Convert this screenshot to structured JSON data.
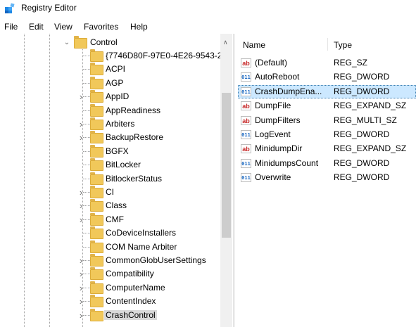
{
  "window": {
    "title": "Registry Editor",
    "app_icon": "registry-icon"
  },
  "menu": [
    "File",
    "Edit",
    "View",
    "Favorites",
    "Help"
  ],
  "tree": {
    "parent": {
      "label": "Control",
      "expanded": true
    },
    "items": [
      {
        "label": "{7746D80F-97E0-4E26-9543-2",
        "expandable": false,
        "selected": false
      },
      {
        "label": "ACPI",
        "expandable": false,
        "selected": false
      },
      {
        "label": "AGP",
        "expandable": false,
        "selected": false
      },
      {
        "label": "AppID",
        "expandable": true,
        "selected": false
      },
      {
        "label": "AppReadiness",
        "expandable": false,
        "selected": false
      },
      {
        "label": "Arbiters",
        "expandable": true,
        "selected": false
      },
      {
        "label": "BackupRestore",
        "expandable": true,
        "selected": false
      },
      {
        "label": "BGFX",
        "expandable": false,
        "selected": false
      },
      {
        "label": "BitLocker",
        "expandable": false,
        "selected": false
      },
      {
        "label": "BitlockerStatus",
        "expandable": false,
        "selected": false
      },
      {
        "label": "CI",
        "expandable": true,
        "selected": false
      },
      {
        "label": "Class",
        "expandable": true,
        "selected": false
      },
      {
        "label": "CMF",
        "expandable": true,
        "selected": false
      },
      {
        "label": "CoDeviceInstallers",
        "expandable": false,
        "selected": false
      },
      {
        "label": "COM Name Arbiter",
        "expandable": false,
        "selected": false
      },
      {
        "label": "CommonGlobUserSettings",
        "expandable": true,
        "selected": false
      },
      {
        "label": "Compatibility",
        "expandable": true,
        "selected": false
      },
      {
        "label": "ComputerName",
        "expandable": true,
        "selected": false
      },
      {
        "label": "ContentIndex",
        "expandable": true,
        "selected": false
      },
      {
        "label": "CrashControl",
        "expandable": true,
        "selected": true
      }
    ]
  },
  "values": {
    "headers": {
      "name": "Name",
      "type": "Type"
    },
    "rows": [
      {
        "name": "(Default)",
        "type": "REG_SZ",
        "icon": "ab",
        "selected": false
      },
      {
        "name": "AutoReboot",
        "type": "REG_DWORD",
        "icon": "bin",
        "selected": false
      },
      {
        "name": "CrashDumpEna...",
        "type": "REG_DWORD",
        "icon": "bin",
        "selected": true
      },
      {
        "name": "DumpFile",
        "type": "REG_EXPAND_SZ",
        "icon": "ab",
        "selected": false
      },
      {
        "name": "DumpFilters",
        "type": "REG_MULTI_SZ",
        "icon": "ab",
        "selected": false
      },
      {
        "name": "LogEvent",
        "type": "REG_DWORD",
        "icon": "bin",
        "selected": false
      },
      {
        "name": "MinidumpDir",
        "type": "REG_EXPAND_SZ",
        "icon": "ab",
        "selected": false
      },
      {
        "name": "MinidumpsCount",
        "type": "REG_DWORD",
        "icon": "bin",
        "selected": false
      },
      {
        "name": "Overwrite",
        "type": "REG_DWORD",
        "icon": "bin",
        "selected": false
      }
    ]
  },
  "icon_glyphs": {
    "ab": "ab",
    "bin": "011"
  },
  "colors": {
    "selection_value": "#cce8ff",
    "selection_tree": "#d9d9d9",
    "folder": "#f1c85a"
  }
}
